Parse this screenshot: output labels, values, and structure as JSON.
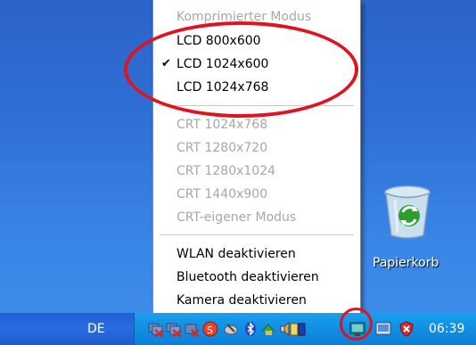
{
  "menu": {
    "items": [
      {
        "label": "Komprimierter Modus",
        "enabled": false,
        "checked": false
      },
      {
        "label": "LCD 800x600",
        "enabled": true,
        "checked": false
      },
      {
        "label": "LCD 1024x600",
        "enabled": true,
        "checked": true
      },
      {
        "label": "LCD 1024x768",
        "enabled": true,
        "checked": false
      },
      {
        "label": "CRT 1024x768",
        "enabled": false,
        "checked": false
      },
      {
        "label": "CRT 1280x720",
        "enabled": false,
        "checked": false
      },
      {
        "label": "CRT 1280x1024",
        "enabled": false,
        "checked": false
      },
      {
        "label": "CRT 1440x900",
        "enabled": false,
        "checked": false
      },
      {
        "label": "CRT-eigener Modus",
        "enabled": false,
        "checked": false
      },
      {
        "label": "WLAN deaktivieren",
        "enabled": true,
        "checked": false
      },
      {
        "label": "Bluetooth deaktivieren",
        "enabled": true,
        "checked": false
      },
      {
        "label": "Kamera deaktivieren",
        "enabled": true,
        "checked": false
      }
    ],
    "check_glyph": "✔"
  },
  "desktop": {
    "recycle_bin_label": "Papierkorb"
  },
  "taskbar": {
    "language": "DE",
    "clock": "06:39",
    "tray_icons": [
      "network-disconnected-icon",
      "network-disconnected-icon",
      "network-disconnected-icon",
      "security-red-icon",
      "satellite-icon",
      "bluetooth-icon",
      "connection-icon",
      "volume-icon",
      "display-settings-icon",
      "screen-icon",
      "shield-icon"
    ]
  },
  "colors": {
    "annotation": "#e0141e",
    "disabled_text": "#a7a7a7"
  }
}
